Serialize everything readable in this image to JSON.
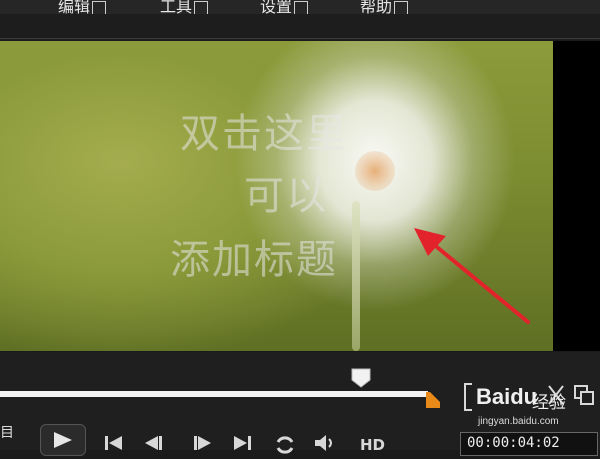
{
  "menu": {
    "items": [
      {
        "label": "编辑",
        "key": "E"
      },
      {
        "label": "工具",
        "key": "T"
      },
      {
        "label": "设置",
        "key": "S"
      },
      {
        "label": "帮助",
        "key": "H"
      }
    ]
  },
  "preview": {
    "title_lines": [
      "双击这里",
      "可以",
      "添加标题"
    ]
  },
  "controls": {
    "project_label": "目",
    "hd_label": "HD",
    "timecode": "00:00:04:02"
  },
  "watermark": {
    "brand": "Baidu",
    "brand_cn": "经验",
    "site": "jingyan.baidu.com"
  },
  "colors": {
    "arrow": "#e3232b",
    "accent_orange": "#e88a1a"
  },
  "icons": [
    "scrubber-handle-icon",
    "end-marker-icon",
    "mark-in-icon",
    "cut-icon",
    "copy-icon",
    "play-icon",
    "previous-icon",
    "step-back-icon",
    "step-forward-icon",
    "next-icon",
    "repeat-icon",
    "volume-icon"
  ]
}
